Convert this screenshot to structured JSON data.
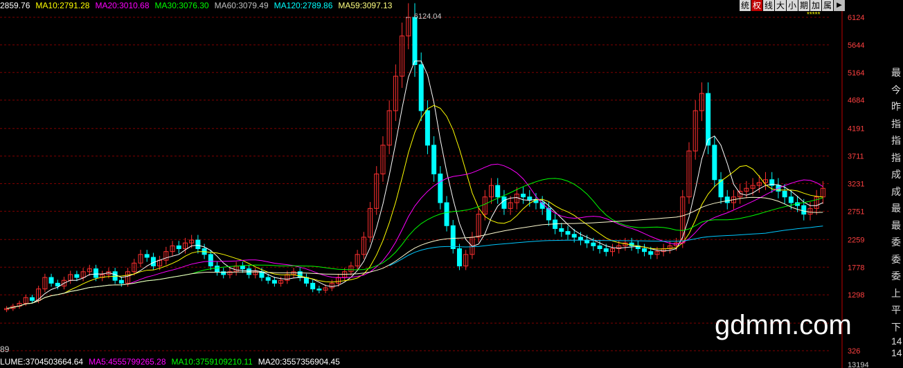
{
  "ma_bar": [
    {
      "label": "2859.76",
      "color": "#ffffff"
    },
    {
      "label": "MA10:2791.28",
      "color": "#ffff00"
    },
    {
      "label": "MA20:3010.68",
      "color": "#ff00ff"
    },
    {
      "label": "MA30:3076.30",
      "color": "#00ff00"
    },
    {
      "label": "MA60:3079.49",
      "color": "#c0c0c0"
    },
    {
      "label": "MA120:2789.86",
      "color": "#00ffff"
    },
    {
      "label": "MA59:3097.13",
      "color": "#ffff80"
    }
  ],
  "toolbar": {
    "items": [
      "统",
      "权",
      "线",
      "大",
      "小",
      "期",
      "加",
      "属"
    ],
    "active_index": 1,
    "play_icon": "play-icon"
  },
  "stars": "*****",
  "right_panel": {
    "items": [
      "最",
      "今",
      "昨",
      "指",
      "指",
      "指",
      "成",
      "成",
      "最",
      "最",
      "委",
      "委",
      "委",
      "上",
      "平",
      "下"
    ],
    "bottom": [
      "14",
      "14"
    ]
  },
  "volume_bar": [
    {
      "label": "LUME:3704503664.64",
      "color": "#ffffff"
    },
    {
      "label": "MA5:4555799265.28",
      "color": "#ff00ff"
    },
    {
      "label": "MA10:3759109210.11",
      "color": "#00ff00"
    },
    {
      "label": "MA20:3557356904.45",
      "color": "#ffffff"
    }
  ],
  "left_cut_label": "89",
  "watermark": "gdmm.com",
  "colors": {
    "up": "#ff3030",
    "down": "#00ffff",
    "grid": "#800000",
    "axis_text": "#ff4040"
  },
  "chart_data": {
    "type": "candlestick",
    "y_ticks": [
      326,
      806,
      1298,
      1778,
      2259,
      2751,
      3231,
      3711,
      4191,
      4684,
      5164,
      5644,
      6124
    ],
    "y_tick_labels": [
      "326",
      "",
      "1298",
      "1778",
      "2259",
      "2751",
      "3231",
      "3711",
      "4191",
      "4684",
      "5164",
      "5644",
      "6124"
    ],
    "ylim": [
      326,
      6124
    ],
    "volume_axis_label": "13194",
    "annotation": {
      "label": "6124.04",
      "value": 6124.04
    },
    "closes": [
      1060,
      1100,
      1150,
      1250,
      1200,
      1400,
      1600,
      1500,
      1450,
      1550,
      1650,
      1600,
      1700,
      1750,
      1600,
      1650,
      1700,
      1550,
      1500,
      1700,
      1850,
      2000,
      1950,
      1800,
      1900,
      2050,
      2150,
      2100,
      2200,
      2250,
      2100,
      2000,
      1800,
      1700,
      1650,
      1700,
      1800,
      1750,
      1650,
      1700,
      1600,
      1550,
      1500,
      1550,
      1650,
      1700,
      1600,
      1500,
      1400,
      1380,
      1420,
      1500,
      1600,
      1700,
      1800,
      2000,
      2300,
      2800,
      3400,
      3900,
      4500,
      5100,
      5800,
      6124,
      5300,
      4500,
      3900,
      3400,
      2900,
      2500,
      2100,
      1800,
      2000,
      2300,
      2700,
      3000,
      3200,
      3000,
      2800,
      2900,
      3050,
      3000,
      2950,
      2900,
      2800,
      2600,
      2450,
      2400,
      2350,
      2300,
      2250,
      2200,
      2150,
      2100,
      2050,
      2100,
      2150,
      2200,
      2150,
      2100,
      2050,
      2000,
      2050,
      2100,
      2150,
      2200,
      3000,
      3800,
      4500,
      4800,
      3900,
      3300,
      3000,
      2900,
      3000,
      3100,
      3150,
      3200,
      3250,
      3300,
      3200,
      3100,
      3000,
      2900,
      2850,
      2700,
      2800,
      3000,
      3150
    ]
  }
}
